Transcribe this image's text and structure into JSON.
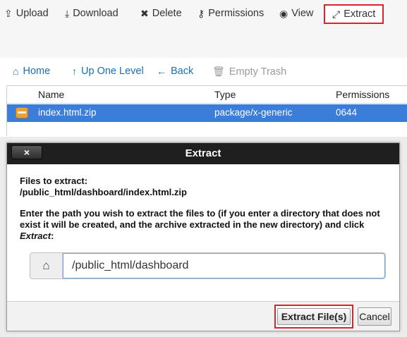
{
  "toolbar": {
    "items": [
      {
        "label": "Upload",
        "icon": "upload-icon",
        "glyph": "⇪"
      },
      {
        "label": "Download",
        "icon": "download-icon",
        "glyph": "⤓"
      },
      {
        "label": "Delete",
        "icon": "close-icon",
        "glyph": "✖"
      },
      {
        "label": "Permissions",
        "icon": "key-icon",
        "glyph": "⚷"
      },
      {
        "label": "View",
        "icon": "eye-icon",
        "glyph": "◉"
      },
      {
        "label": "Extract",
        "icon": "expand-icon",
        "glyph": "⤢"
      }
    ]
  },
  "nav": {
    "home": "Home",
    "up_one_level": "Up One Level",
    "back": "Back",
    "empty_trash": "Empty Trash"
  },
  "table": {
    "columns": [
      "Name",
      "Type",
      "Permissions"
    ],
    "rows": [
      {
        "name": "index.html.zip",
        "type": "package/x-generic",
        "permissions": "0644"
      }
    ]
  },
  "dialog": {
    "title": "Extract",
    "close_label": "×",
    "files_label": "Files to extract:",
    "files_path": "/public_html/dashboard/index.html.zip",
    "instruction_prefix": "Enter the path you wish to extract the files to (if you enter a directory that does not exist it will be created, and the archive extracted in the new directory) and click ",
    "instruction_emph": "Extract",
    "instruction_suffix": ":",
    "path_value": "/public_html/dashboard",
    "extract_button": "Extract File(s)",
    "cancel_button": "Cancel"
  },
  "colors": {
    "accent_link": "#1a6fb4",
    "selected_row": "#3b7dd8",
    "highlight_box": "#d9232d"
  }
}
